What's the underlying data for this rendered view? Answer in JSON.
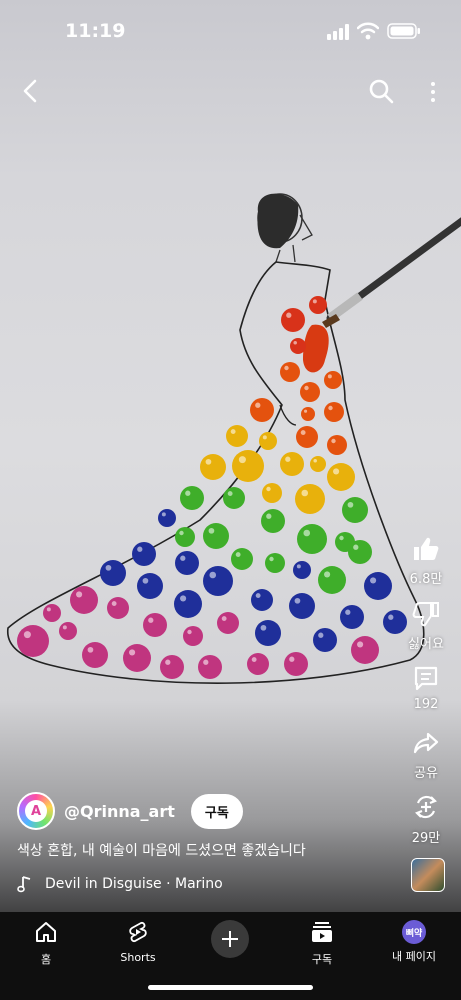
{
  "status": {
    "time": "11:19"
  },
  "video": {
    "channel_handle": "@Qrinna_art",
    "avatar_letter": "A",
    "subscribe_label": "구독",
    "caption": "색상 혼합, 내 예술이 마음에 드셨으면 좋겠습니다",
    "music": "Devil in Disguise · Marino"
  },
  "actions": {
    "like_count": "6.8만",
    "dislike_label": "싫어요",
    "comment_count": "192",
    "share_label": "공유",
    "remix_count": "29만"
  },
  "nav": {
    "home_label": "홈",
    "shorts_label": "Shorts",
    "subscriptions_label": "구독",
    "me_label": "내 페이지",
    "me_avatar_text": "삐약"
  },
  "icons": [
    "back-icon",
    "search-icon",
    "more-vert-icon",
    "like-icon",
    "dislike-icon",
    "comment-icon",
    "share-icon",
    "remix-icon",
    "music-note-icon",
    "home-icon",
    "shorts-icon",
    "add-icon",
    "subscriptions-icon"
  ]
}
